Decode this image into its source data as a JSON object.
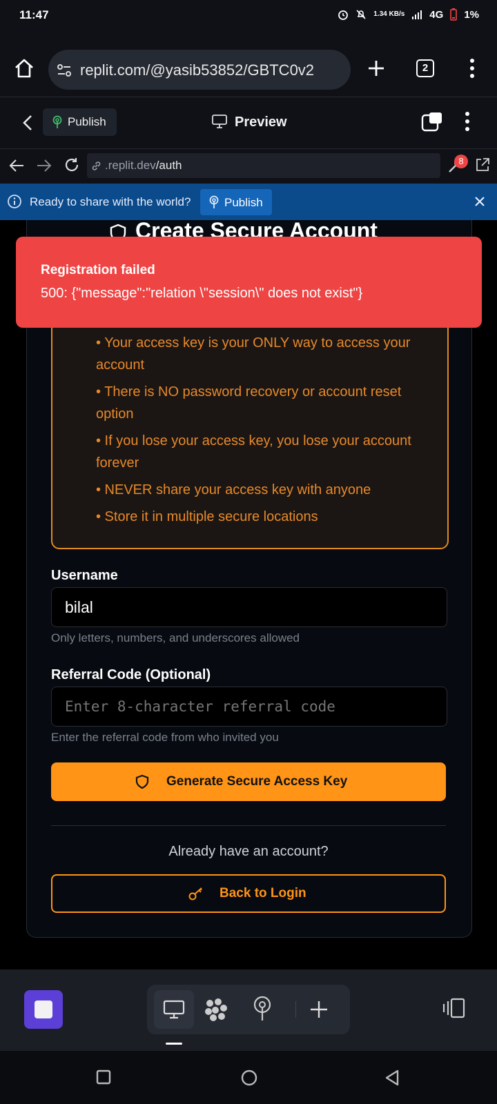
{
  "status_bar": {
    "time": "11:47",
    "network": "4G",
    "battery": "1%",
    "speed": "1.34 KB/s"
  },
  "browser": {
    "url": "replit.com/@yasib53852/GBTC0v2",
    "tab_count": "2"
  },
  "replit_bar": {
    "publish_label": "Publish",
    "preview_label": "Preview"
  },
  "inner_nav": {
    "url_domain": ".replit.dev",
    "url_path": "/auth",
    "badge_count": "8"
  },
  "banner": {
    "text": "Ready to share with the world?",
    "publish_label": "Publish"
  },
  "page": {
    "title": "Create Secure Account",
    "warnings": [
      "• Your access key is your ONLY way to access your account",
      "• There is NO password recovery or account reset option",
      "• If you lose your access key, you lose your account forever",
      "• NEVER share your access key with anyone",
      "• Store it in multiple secure locations"
    ],
    "username_label": "Username",
    "username_value": "bilal",
    "username_hint": "Only letters, numbers, and underscores allowed",
    "referral_label": "Referral Code (Optional)",
    "referral_placeholder": "Enter 8-character referral code",
    "referral_hint": "Enter the referral code from who invited you",
    "generate_label": "Generate Secure Access Key",
    "already_text": "Already have an account?",
    "back_login_label": "Back to Login"
  },
  "toast": {
    "title": "Registration failed",
    "message": "500: {\"message\":\"relation \\\"session\\\" does not exist\"}"
  },
  "colors": {
    "accent": "#ff9416",
    "toast": "#ef4444",
    "banner": "#0b4a8b",
    "warning_text": "#e8892a"
  }
}
